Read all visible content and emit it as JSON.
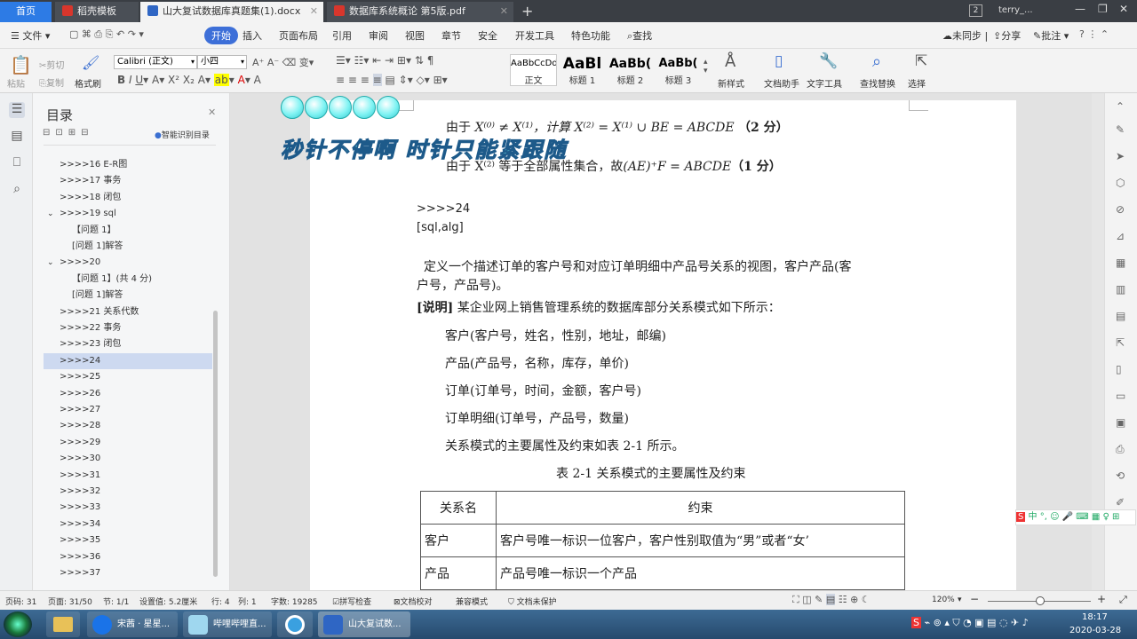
{
  "tabs": [
    {
      "label": "首页"
    },
    {
      "label": "稻壳模板"
    },
    {
      "label": "山大复试数据库真题集(1).docx"
    },
    {
      "label": "数据库系统概论 第5版.pdf"
    }
  ],
  "window": {
    "badge": "2",
    "user": "terry_..."
  },
  "menu": {
    "file": "文件",
    "items": [
      "开始",
      "插入",
      "页面布局",
      "引用",
      "审阅",
      "视图",
      "章节",
      "安全",
      "开发工具",
      "特色功能"
    ],
    "search": "查找",
    "sync": "未同步",
    "share": "分享",
    "annotate": "批注"
  },
  "ribbon": {
    "paste": "粘贴",
    "cut": "剪切",
    "copy": "复制",
    "format_painter": "格式刷",
    "font_name": "Calibri (正文)",
    "font_size": "小四",
    "styles": [
      {
        "preview": "AaBbCcDd",
        "name": "正文"
      },
      {
        "preview": "AaBl",
        "name": "标题 1"
      },
      {
        "preview": "AaBb(",
        "name": "标题 2"
      },
      {
        "preview": "AaBb(",
        "name": "标题 3"
      }
    ],
    "new_style": "新样式",
    "doc_assistant": "文档助手",
    "text_tools": "文字工具",
    "find_replace": "查找替换",
    "select": "选择"
  },
  "outline": {
    "title": "目录",
    "smart": "智能识别目录",
    "items": [
      ">>>>16 E-R图",
      ">>>>17 事务",
      ">>>>18 闭包",
      ">>>>19 sql",
      "【问题 1】",
      "[问题 1]解答",
      ">>>>20",
      "【问题 1】(共 4 分)",
      "[问题 1]解答",
      ">>>>21 关系代数",
      ">>>>22 事务",
      ">>>>23 闭包",
      ">>>>24",
      ">>>>25",
      ">>>>26",
      ">>>>27",
      ">>>>28",
      ">>>>29",
      ">>>>30",
      ">>>>31",
      ">>>>32",
      ">>>>33",
      ">>>>34",
      ">>>>35",
      ">>>>36",
      ">>>>37"
    ],
    "selected": ">>>>24"
  },
  "overlay": {
    "caption": "秒针不停啊 时针只能紧跟随"
  },
  "doc": {
    "line1_prefix": "由于",
    "line1_formula": "X⁽⁰⁾ ≠ X⁽¹⁾，计算 X⁽²⁾ = X⁽¹⁾ ∪ BE = ABCDE",
    "line1_score": "（2 分）",
    "line2_prefix": "由于 X⁽²⁾ 等于全部属性集合，故",
    "line2_formula": "(AE)⁺F = ABCDE",
    "line2_score": "（1 分）",
    "heading": ">>>>24",
    "tag": "[sql,alg]",
    "question1": "定义一个描述订单的客户号和对应订单明细中产品号关系的视图，客户产品(客",
    "question2": "户号，产品号)。",
    "desc_label": "[说明]",
    "desc": "某企业网上销售管理系统的数据库部分关系模式如下所示：",
    "schemas": [
      "客户(客户号，姓名，性别，地址，邮编)",
      "产品(产品号，名称，库存，单价)",
      "订单(订单号，时间，金额，客户号)",
      "订单明细(订单号，产品号，数量)",
      "关系模式的主要属性及约束如表 2-1 所示。"
    ],
    "table_caption": "表 2-1 关系模式的主要属性及约束",
    "table_header": [
      "关系名",
      "约束"
    ],
    "table_rows": [
      [
        "客户",
        "客户号唯一标识一位客户，客户性别取值为“男”或者“女’"
      ],
      [
        "产品",
        "产品号唯一标识一个产品"
      ]
    ]
  },
  "status": {
    "page_code": "页码: 31",
    "page": "页面: 31/50",
    "section": "节: 1/1",
    "setting": "设置值: 5.2厘米",
    "row": "行: 4",
    "col": "列: 1",
    "words": "字数: 19285",
    "spell": "拼写检查",
    "proof": "文档校对",
    "compat": "兼容模式",
    "protect": "文档未保护",
    "zoom": "120%"
  },
  "taskbar": {
    "items": [
      "宋茜 · 星星...",
      "哔哩哔哩直...",
      "山大复试数..."
    ],
    "time": "18:17",
    "date": "2020-03-28"
  }
}
